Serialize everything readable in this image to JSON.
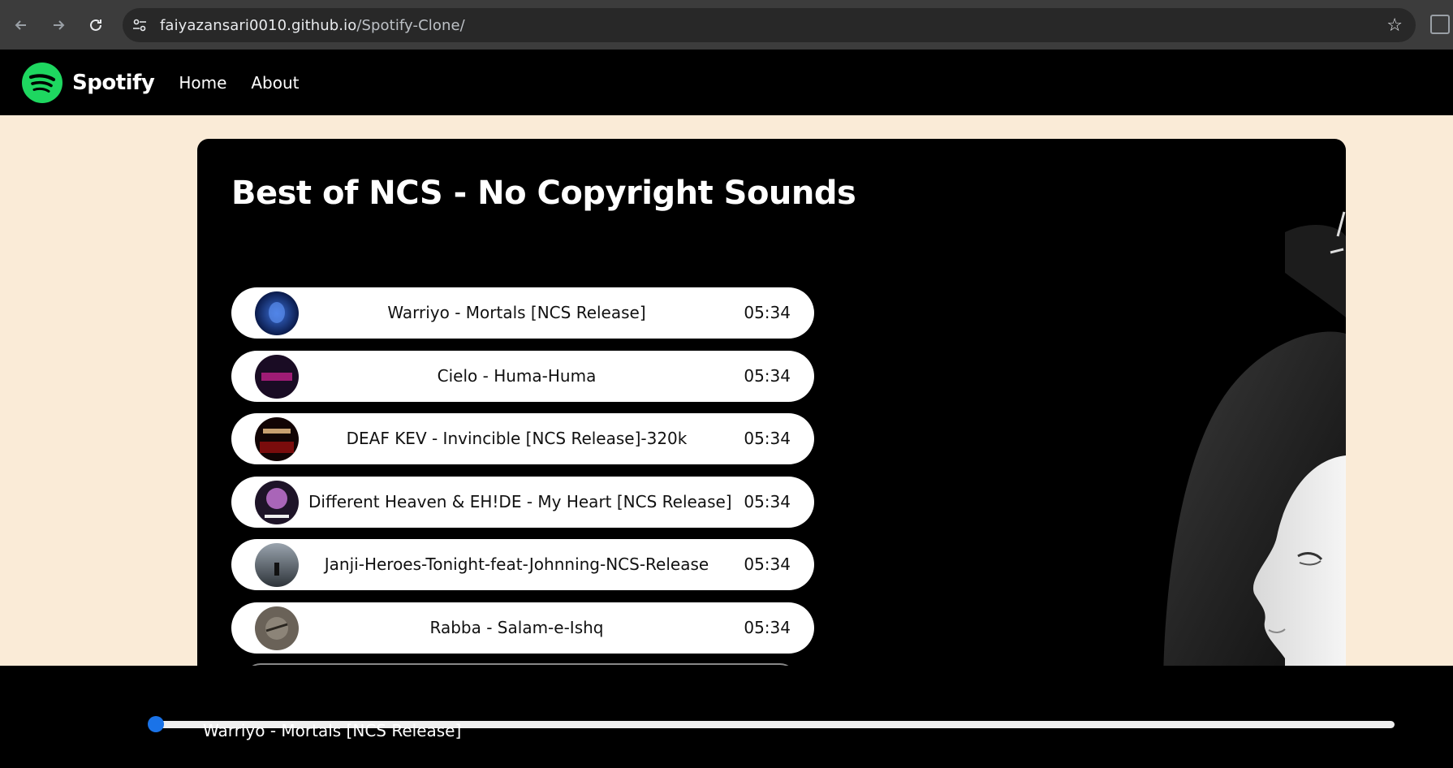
{
  "browser": {
    "url_host": "faiyazansari0010.github.io",
    "url_path": "/Spotify-Clone/"
  },
  "site": {
    "brand": "Spotify",
    "nav": [
      {
        "label": "Home"
      },
      {
        "label": "About"
      }
    ],
    "accent_color": "#1ed760"
  },
  "playlist": {
    "title": "Best of NCS - No Copyright Sounds",
    "songs": [
      {
        "name": "Warriyo - Mortals [NCS Release]",
        "duration": "05:34"
      },
      {
        "name": "Cielo - Huma-Huma",
        "duration": "05:34"
      },
      {
        "name": "DEAF KEV - Invincible [NCS Release]-320k",
        "duration": "05:34"
      },
      {
        "name": "Different Heaven & EH!DE - My Heart [NCS Release]",
        "duration": "05:34"
      },
      {
        "name": "Janji-Heroes-Tonight-feat-Johnning-NCS-Release",
        "duration": "05:34"
      },
      {
        "name": "Rabba - Salam-e-Ishq",
        "duration": "05:34"
      }
    ]
  },
  "player": {
    "now_playing": "Warriyo - Mortals [NCS Release]",
    "progress": 0.0,
    "slider_color": "#1a73e8"
  }
}
